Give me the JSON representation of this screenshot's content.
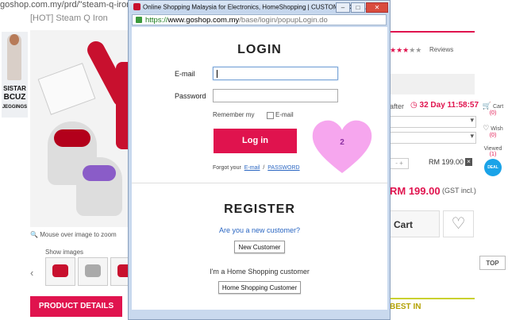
{
  "background": {
    "url_text": "goshop.com.my/prd/\"steam-q-iron",
    "breadcrumb": "[HOT] Steam Q Iron",
    "side_ad": {
      "line1": "SISTAR",
      "line2": "BCUZ",
      "line3": "JEGGINGS"
    },
    "zoom_hint": "Mouse over image to zoom",
    "show_images": "Show images",
    "product_details_tab": "PRODUCT DETAILS",
    "reviews_label": "Reviews",
    "countdown_prefix": "after",
    "countdown": "32 Day 11:58:57",
    "unit_price": "RM 199.00",
    "total_price": "RM 199.00",
    "gst_note": "(GST incl.)",
    "cart_label": "Cart",
    "best_in_label": "BEST IN",
    "right_column": {
      "cart_label": "Cart",
      "cart_count": "(0)",
      "wish_label": "Wish",
      "wish_count": "(0)",
      "viewed_label": "Viewed",
      "viewed_count": "(1)",
      "deal_badge": "DEAL",
      "top_button": "TOP"
    }
  },
  "popup": {
    "window_title": "Online Shopping Malaysia for Electronics, HomeShopping | CUSTOMER CEN...",
    "window_buttons": {
      "minimize": "–",
      "maximize": "□",
      "close": "✕"
    },
    "address": {
      "scheme": "https://",
      "domain": "www.goshop.com.my",
      "path": "/base/login/popupLogin.do"
    },
    "login": {
      "title": "LOGIN",
      "email_label": "E-mail",
      "email_value": "",
      "password_label": "Password",
      "password_value": "",
      "remember_label": "Remember my",
      "remember_option": "E-mail",
      "login_button": "Log in",
      "forgot_prefix": "Forgot your",
      "forgot_email": "E-mail",
      "forgot_sep": "/",
      "forgot_password": "PASSWORD"
    },
    "annotation": {
      "number": "2",
      "color": "#f6a6ee"
    },
    "register": {
      "title": "REGISTER",
      "new_question": "Are you a new customer?",
      "new_button": "New Customer",
      "hs_question": "I'm a Home Shopping customer",
      "hs_button": "Home Shopping Customer"
    }
  },
  "colors": {
    "accent": "#e0134e",
    "link": "#2a66c2"
  }
}
